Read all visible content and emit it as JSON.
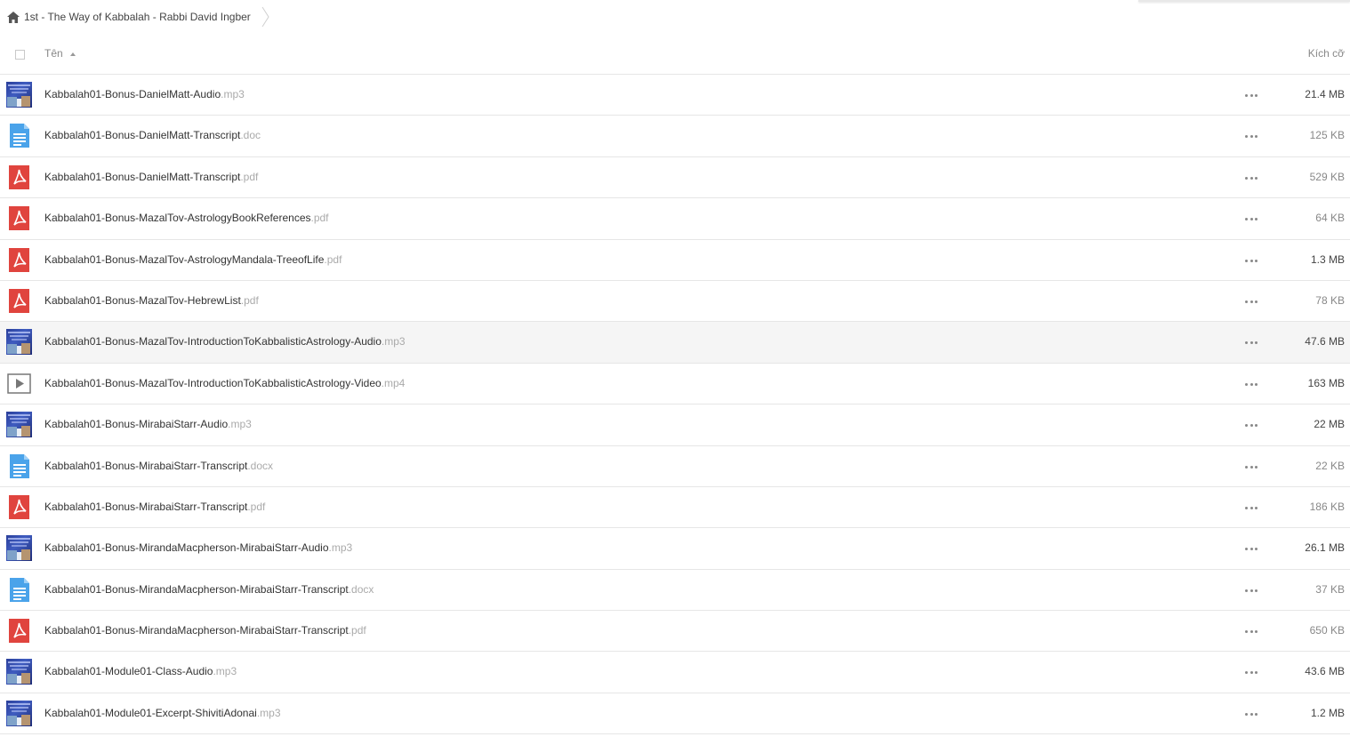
{
  "breadcrumb": {
    "path": "1st - The Way of Kabbalah - Rabbi David Ingber"
  },
  "header": {
    "name_label": "Tên",
    "size_label": "Kích cỡ"
  },
  "files": [
    {
      "name": "Kabbalah01-Bonus-DanielMatt-Audio",
      "ext": ".mp3",
      "size": "21.4 MB",
      "icon": "audio-thumbnail-icon"
    },
    {
      "name": "Kabbalah01-Bonus-DanielMatt-Transcript",
      "ext": ".doc",
      "size": "125 KB",
      "icon": "document-icon"
    },
    {
      "name": "Kabbalah01-Bonus-DanielMatt-Transcript",
      "ext": ".pdf",
      "size": "529 KB",
      "icon": "pdf-icon"
    },
    {
      "name": "Kabbalah01-Bonus-MazalTov-AstrologyBookReferences",
      "ext": ".pdf",
      "size": "64 KB",
      "icon": "pdf-icon"
    },
    {
      "name": "Kabbalah01-Bonus-MazalTov-AstrologyMandala-TreeofLife",
      "ext": ".pdf",
      "size": "1.3 MB",
      "icon": "pdf-icon"
    },
    {
      "name": "Kabbalah01-Bonus-MazalTov-HebrewList",
      "ext": ".pdf",
      "size": "78 KB",
      "icon": "pdf-icon"
    },
    {
      "name": "Kabbalah01-Bonus-MazalTov-IntroductionToKabbalisticAstrology-Audio",
      "ext": ".mp3",
      "size": "47.6 MB",
      "icon": "audio-thumbnail-icon"
    },
    {
      "name": "Kabbalah01-Bonus-MazalTov-IntroductionToKabbalisticAstrology-Video",
      "ext": ".mp4",
      "size": "163 MB",
      "icon": "video-icon"
    },
    {
      "name": "Kabbalah01-Bonus-MirabaiStarr-Audio",
      "ext": ".mp3",
      "size": "22 MB",
      "icon": "audio-thumbnail-icon"
    },
    {
      "name": "Kabbalah01-Bonus-MirabaiStarr-Transcript",
      "ext": ".docx",
      "size": "22 KB",
      "icon": "document-icon"
    },
    {
      "name": "Kabbalah01-Bonus-MirabaiStarr-Transcript",
      "ext": ".pdf",
      "size": "186 KB",
      "icon": "pdf-icon"
    },
    {
      "name": "Kabbalah01-Bonus-MirandaMacpherson-MirabaiStarr-Audio",
      "ext": ".mp3",
      "size": "26.1 MB",
      "icon": "audio-thumbnail-icon"
    },
    {
      "name": "Kabbalah01-Bonus-MirandaMacpherson-MirabaiStarr-Transcript",
      "ext": ".docx",
      "size": "37 KB",
      "icon": "document-icon"
    },
    {
      "name": "Kabbalah01-Bonus-MirandaMacpherson-MirabaiStarr-Transcript",
      "ext": ".pdf",
      "size": "650 KB",
      "icon": "pdf-icon"
    },
    {
      "name": "Kabbalah01-Module01-Class-Audio",
      "ext": ".mp3",
      "size": "43.6 MB",
      "icon": "audio-thumbnail-icon"
    },
    {
      "name": "Kabbalah01-Module01-Excerpt-ShivitiAdonai",
      "ext": ".mp3",
      "size": "1.2 MB",
      "icon": "audio-thumbnail-icon"
    }
  ],
  "colors": {
    "pdf": "#e0443e",
    "doc": "#4aa3ea",
    "video": "#777777",
    "divider": "#e6e6e6",
    "row_highlight": "#f5f5f5"
  }
}
